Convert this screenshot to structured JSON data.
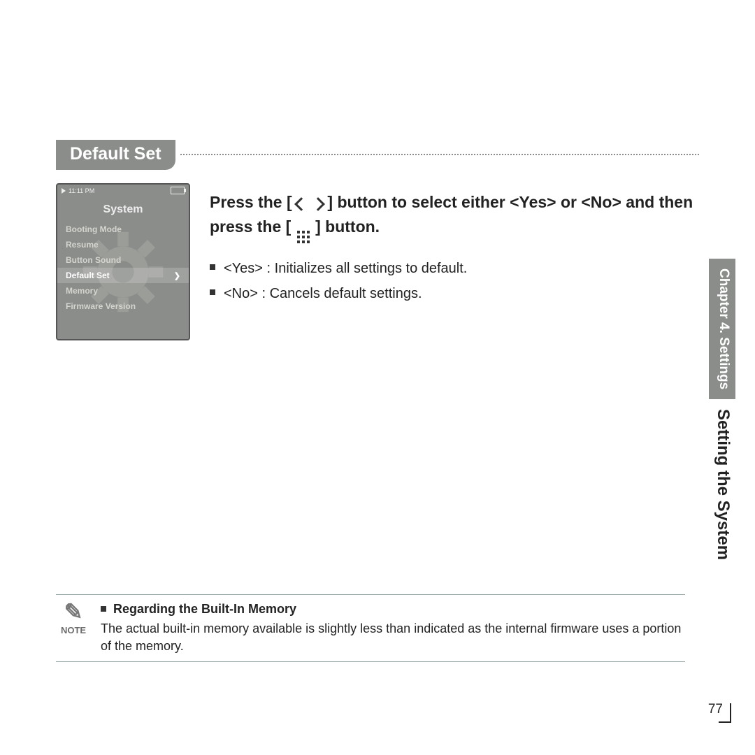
{
  "section_title": "Default Set",
  "device": {
    "time": "11:11 PM",
    "title": "System",
    "items": [
      {
        "label": "Booting Mode"
      },
      {
        "label": "Resume"
      },
      {
        "label": "Button Sound"
      },
      {
        "label": "Default Set",
        "selected": true
      },
      {
        "label": "Memory"
      },
      {
        "label": "Firmware Version"
      }
    ]
  },
  "instruction": {
    "part1": "Press the [",
    "part2": "] button to select either <Yes> or <No> and then press the [",
    "part3": "] button."
  },
  "bullets": [
    "<Yes> :  Initializes all settings to default.",
    "<No> : Cancels default settings."
  ],
  "note": {
    "label": "NOTE",
    "heading": "Regarding the Built-In Memory",
    "body": "The actual built-in memory available is slightly less than indicated as the internal firmware uses a portion of the memory."
  },
  "sidebar": {
    "chapter": "Chapter 4. Settings",
    "section": "Setting the System"
  },
  "page_number": "77"
}
